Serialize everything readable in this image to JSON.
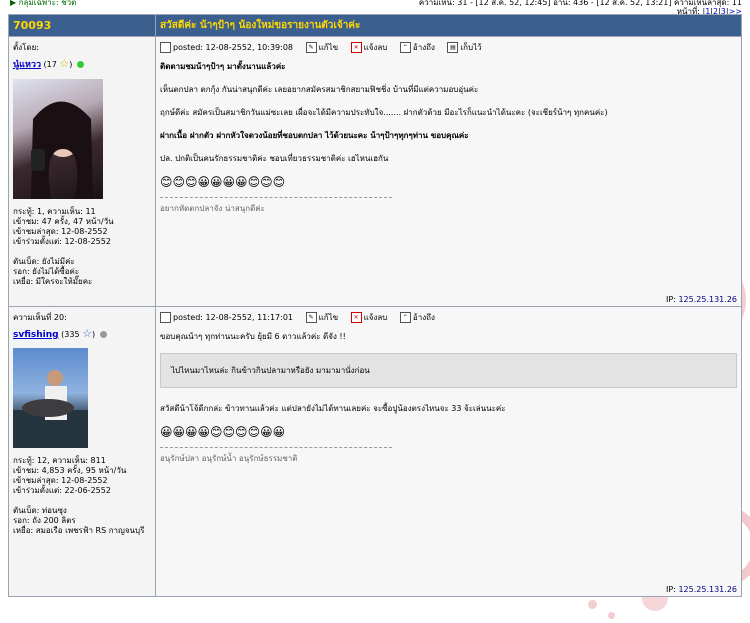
{
  "top": {
    "left_text": "▶ กลุ่มเฉพาะ: ชีวิต",
    "right_text": "ความเห็น: 31 - [12 ส.ค. 52, 12:45] อ่าน: 436 - [12 ส.ค. 52, 13:21] ความเห็นล่าสุด: 11",
    "pages_label": "หน้าที่:",
    "pages": [
      "1",
      "2",
      "3",
      ">>"
    ]
  },
  "header": {
    "topic_id": "70093",
    "title": "สวัสดีค่ะ น้าๆป้าๆ น้องใหม่ขอรายงานตัวเจ้าค่ะ"
  },
  "posts": [
    {
      "author_label": "ตั้งโดย:",
      "username": "นู๋แหวว",
      "score": "(17",
      "online": true,
      "stats": [
        "กระทู้: 1, ความเห็น: 11",
        "เข้าชม: 47 ครั้ง, 47 หน้า/วัน",
        "เข้าชมล่าสุด: 12-08-2552",
        "เข้าร่วมตั้งแต่: 12-08-2552"
      ],
      "extra": [
        "ตันเบ็ด: ยังไม่มีค่ะ",
        "รอก: ยังไม่ได้ซื้อค่ะ",
        "เหยื่อ: มีใครจะให้มั๊ยคะ"
      ],
      "posted": "posted: 12-08-2552, 10:39:08",
      "toolbar": [
        "แก้ไข",
        "แจ้งลบ",
        "อ้างถึง",
        "เก็บไว้"
      ],
      "lines": [
        "ติดตามชมน้าๆป้าๆ มาตั้งนานแล้วค่ะ",
        "เห็นตกปลา ตกกุ้ง กันน่าสนุกดีค่ะ เลยอยากสมัครสมาชิกสยามฟิชชิ่ง บ้านที่มีแต่ความอบอุ่นค่ะ",
        "ฤกษ์ดีค่ะ สมัครเป็นสมาชิกวันแม่ซะเลย เผื่อจะได้มีความประทับใจ....... ฝากตัวด้วย มีอะไรก็แนะนำได้นะคะ (จะเชียร์น้าๆ ทุกคนค่ะ)",
        "ฝากเนื้อ ฝากตัว ฝากหัวใจดวงน้อยที่ชอบตกปลา ไว้ด้วยนะคะ น้าๆป้าๆทุกๆท่าน ขอบคุณค่ะ",
        "ปล. ปกติเป็นคนรักธรรมชาติค่ะ ชอบเที่ยวธรรมชาติค่ะ เฮไหนเฮกัน"
      ],
      "smileys": "😊😊😊😀😀😀😀😊😊😊",
      "signature": "อยากหัดตกปลาจัง น่าสนุกดีค่ะ",
      "ip": "125.25.131.26"
    },
    {
      "author_label": "ความเห็นที่ 20:",
      "username": "svfishing",
      "score": "(335",
      "online": false,
      "stats": [
        "กระทู้: 12, ความเห็น: 811",
        "เข้าชม: 4,853 ครั้ง, 95 หน้า/วัน",
        "เข้าชมล่าสุด: 12-08-2552",
        "เข้าร่วมตั้งแต่: 22-06-2552"
      ],
      "extra": [
        "ตันเบ็ด: ท่อนซุง",
        "รอก: ถัง 200 ลิตร",
        "เหยื่อ: สมอเรือ เพชรฟ้า RS กาญจนบุรี"
      ],
      "posted": "posted: 12-08-2552, 11:17:01",
      "toolbar": [
        "แก้ไข",
        "แจ้งลบ",
        "อ้างถึง"
      ],
      "line1": "ขอบคุณน้าๆ ทุกท่านนะครับ ยุ้ยมี 6 ดาวแล้วค่ะ ดีจัง !!",
      "quote": "ไปไหนมาไหนล่ะ กินข้าวกินปลามาหรือยัง มามามานั่งก่อน",
      "line2": "สวัสดีน้าโจ้ดีกกล่ะ ข้าวทานแล้วค่ะ แต่ปลายังไม่ได้ทานเลยค่ะ จะซื้อปูน้องตรงไหนจะ 33 จ้ะเล่นนะค่ะ",
      "smileys": "😀😀😀😀😊😊😊😊😀😀",
      "signature": "อนุรักษ์ปลา อนุรักษ์น้ำ อนุรักษ์ธรรมชาติ",
      "ip": "125.25.131.26"
    }
  ]
}
